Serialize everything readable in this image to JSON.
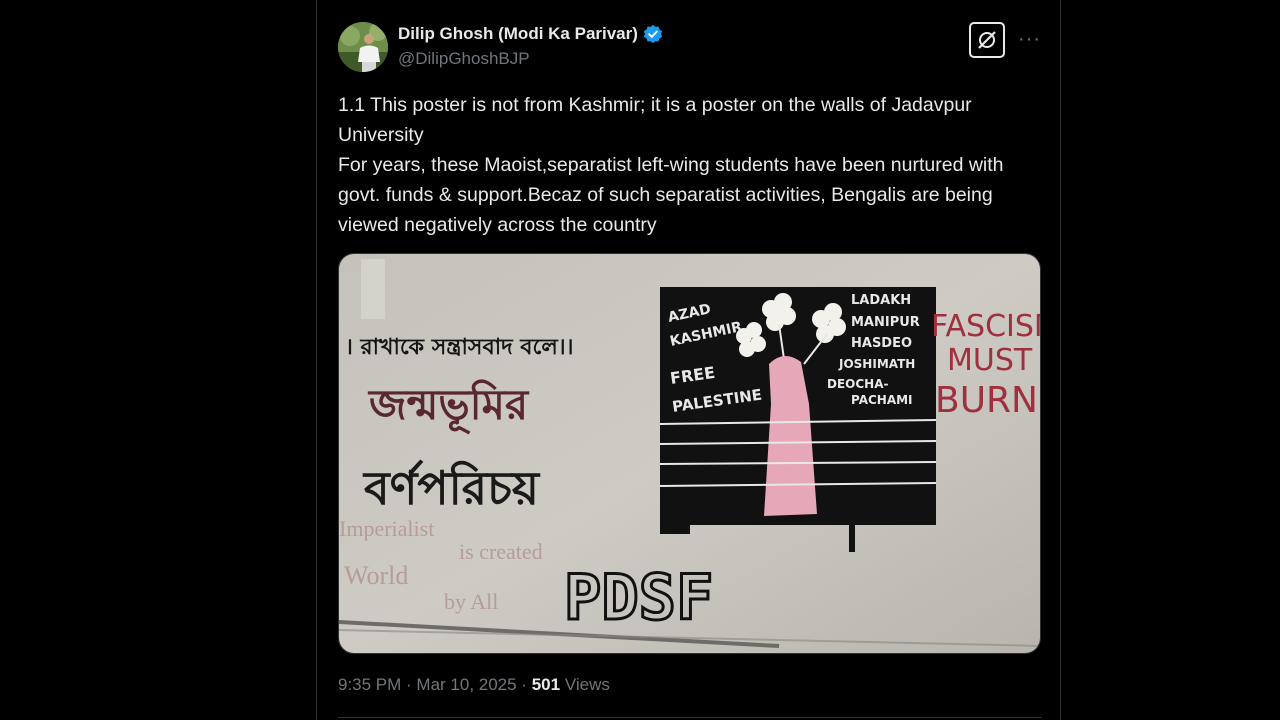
{
  "author": {
    "name": "Dilip Ghosh (Modi Ka Parivar)",
    "handle": "@DilipGhoshBJP",
    "verified_icon": "verified-badge-icon",
    "verified_color": "#1d9bf0"
  },
  "actions": {
    "grok_icon": "grok-icon",
    "more_icon": "more-options-icon",
    "more_label": "···"
  },
  "tweet": {
    "text": "1.1 This poster is not from Kashmir; it is a poster on the walls of Jadavpur University\nFor years, these Maoist,separatist left-wing students have been nurtured with govt. funds & support.Becaz of such separatist activities, Bengalis are being viewed negatively across the country"
  },
  "media": {
    "wall_text_left_1": "। রাখাকে সন্ত্রাসবাদ বলে।।",
    "wall_text_left_2": "জন্মভূমির",
    "wall_text_left_3": "বর্ণপরিচয়",
    "poster_left_1": "AZAD",
    "poster_left_2": "KASHMIR",
    "poster_left_3": "FREE",
    "poster_left_4": "PALESTINE",
    "poster_right_1": "LADAKH",
    "poster_right_2": "MANIPUR",
    "poster_right_3": "HASDEO",
    "poster_right_4": "JOSHIMATH",
    "poster_right_5": "DEOCHA-",
    "poster_right_6": "PACHAMI",
    "slogan_1": "FASCISM",
    "slogan_2": "MUST",
    "slogan_3": "BURN",
    "graffiti_bottom": "PDSF",
    "faded_text_1": "Imperialist",
    "faded_text_2": "is created",
    "faded_text_3": "World",
    "faded_text_4": "by All"
  },
  "meta": {
    "time": "9:35 PM",
    "separator": " · ",
    "date": "Mar 10, 2025",
    "views_count": "501",
    "views_label": " Views"
  },
  "colors": {
    "background": "#000000",
    "text_primary": "#e7e9ea",
    "text_secondary": "#71767b",
    "border": "#2f3336"
  }
}
